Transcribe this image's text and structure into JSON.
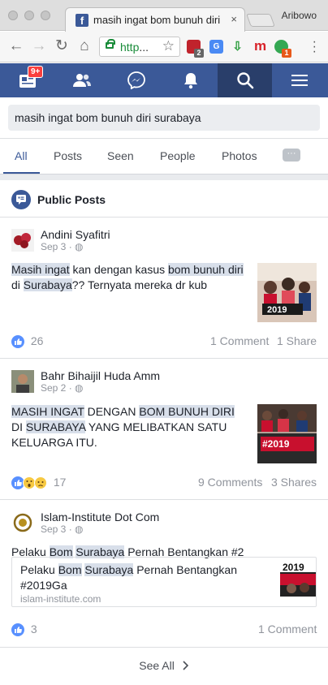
{
  "browser": {
    "tab_title": "masih ingat bom bunuh diri s",
    "tab_close": "×",
    "profile_name": "Aribowo",
    "url_text": "http",
    "url_ellipsis": "...",
    "ext_badge_1": "2",
    "ext_badge_2": "1",
    "ext_m": "m"
  },
  "nav": {
    "notif_count": "9+"
  },
  "search": {
    "query": "masih ingat bom bunuh diri surabaya"
  },
  "tabs": [
    "All",
    "Posts",
    "Seen",
    "People",
    "Photos"
  ],
  "section": {
    "title": "Public Posts"
  },
  "posts": [
    {
      "author": "Andini Syafitri",
      "meta": "Sep 3 · ",
      "text_parts": [
        {
          "t": "Masih ingat",
          "hl": true
        },
        {
          "t": " kan dengan kasus ",
          "hl": false
        },
        {
          "t": "bom bunuh diri",
          "hl": true
        },
        {
          "t": " di ",
          "hl": false
        },
        {
          "t": "Surabaya",
          "hl": true
        },
        {
          "t": "?? Ternyata mereka dr kub",
          "hl": false
        }
      ],
      "reactions": "26",
      "comments": "1 Comment",
      "shares": "1 Share",
      "thumb_text": "2019"
    },
    {
      "author": "Bahr Bihaijil Huda Amm",
      "meta": "Sep 2 · ",
      "text_parts": [
        {
          "t": "MASIH INGAT",
          "hl": true
        },
        {
          "t": " DENGAN ",
          "hl": false
        },
        {
          "t": "BOM BUNUH DIRI",
          "hl": true
        },
        {
          "t": " DI ",
          "hl": false
        },
        {
          "t": "SURABAYA",
          "hl": true
        },
        {
          "t": " YANG MELIBATKAN SATU KELUARGA ITU.",
          "hl": false
        }
      ],
      "reactions": "17",
      "comments": "9 Comments",
      "shares": "3 Shares",
      "thumb_text": "#2019"
    },
    {
      "author": "Islam-Institute Dot Com",
      "meta": "Sep 3 · ",
      "text_parts": [
        {
          "t": "Pelaku ",
          "hl": false
        },
        {
          "t": "Bom",
          "hl": true
        },
        {
          "t": " ",
          "hl": false
        },
        {
          "t": "Surabaya",
          "hl": true
        },
        {
          "t": " Pernah Bentangkan #2",
          "hl": false
        }
      ],
      "link": {
        "title_parts": [
          {
            "t": "Pelaku ",
            "hl": false
          },
          {
            "t": "Bom",
            "hl": true
          },
          {
            "t": " ",
            "hl": false
          },
          {
            "t": "Surabaya",
            "hl": true
          },
          {
            "t": " Pernah Bentangkan #2019Ga",
            "hl": false
          }
        ],
        "domain": "islam-institute.com",
        "thumb_text": "2019"
      },
      "reactions": "3",
      "comments": "1 Comment"
    }
  ],
  "footer": {
    "see_all": "See All"
  },
  "colors": {
    "fb_blue": "#3b5998",
    "highlight": "#d8dfea",
    "like_blue": "#5890ff"
  }
}
